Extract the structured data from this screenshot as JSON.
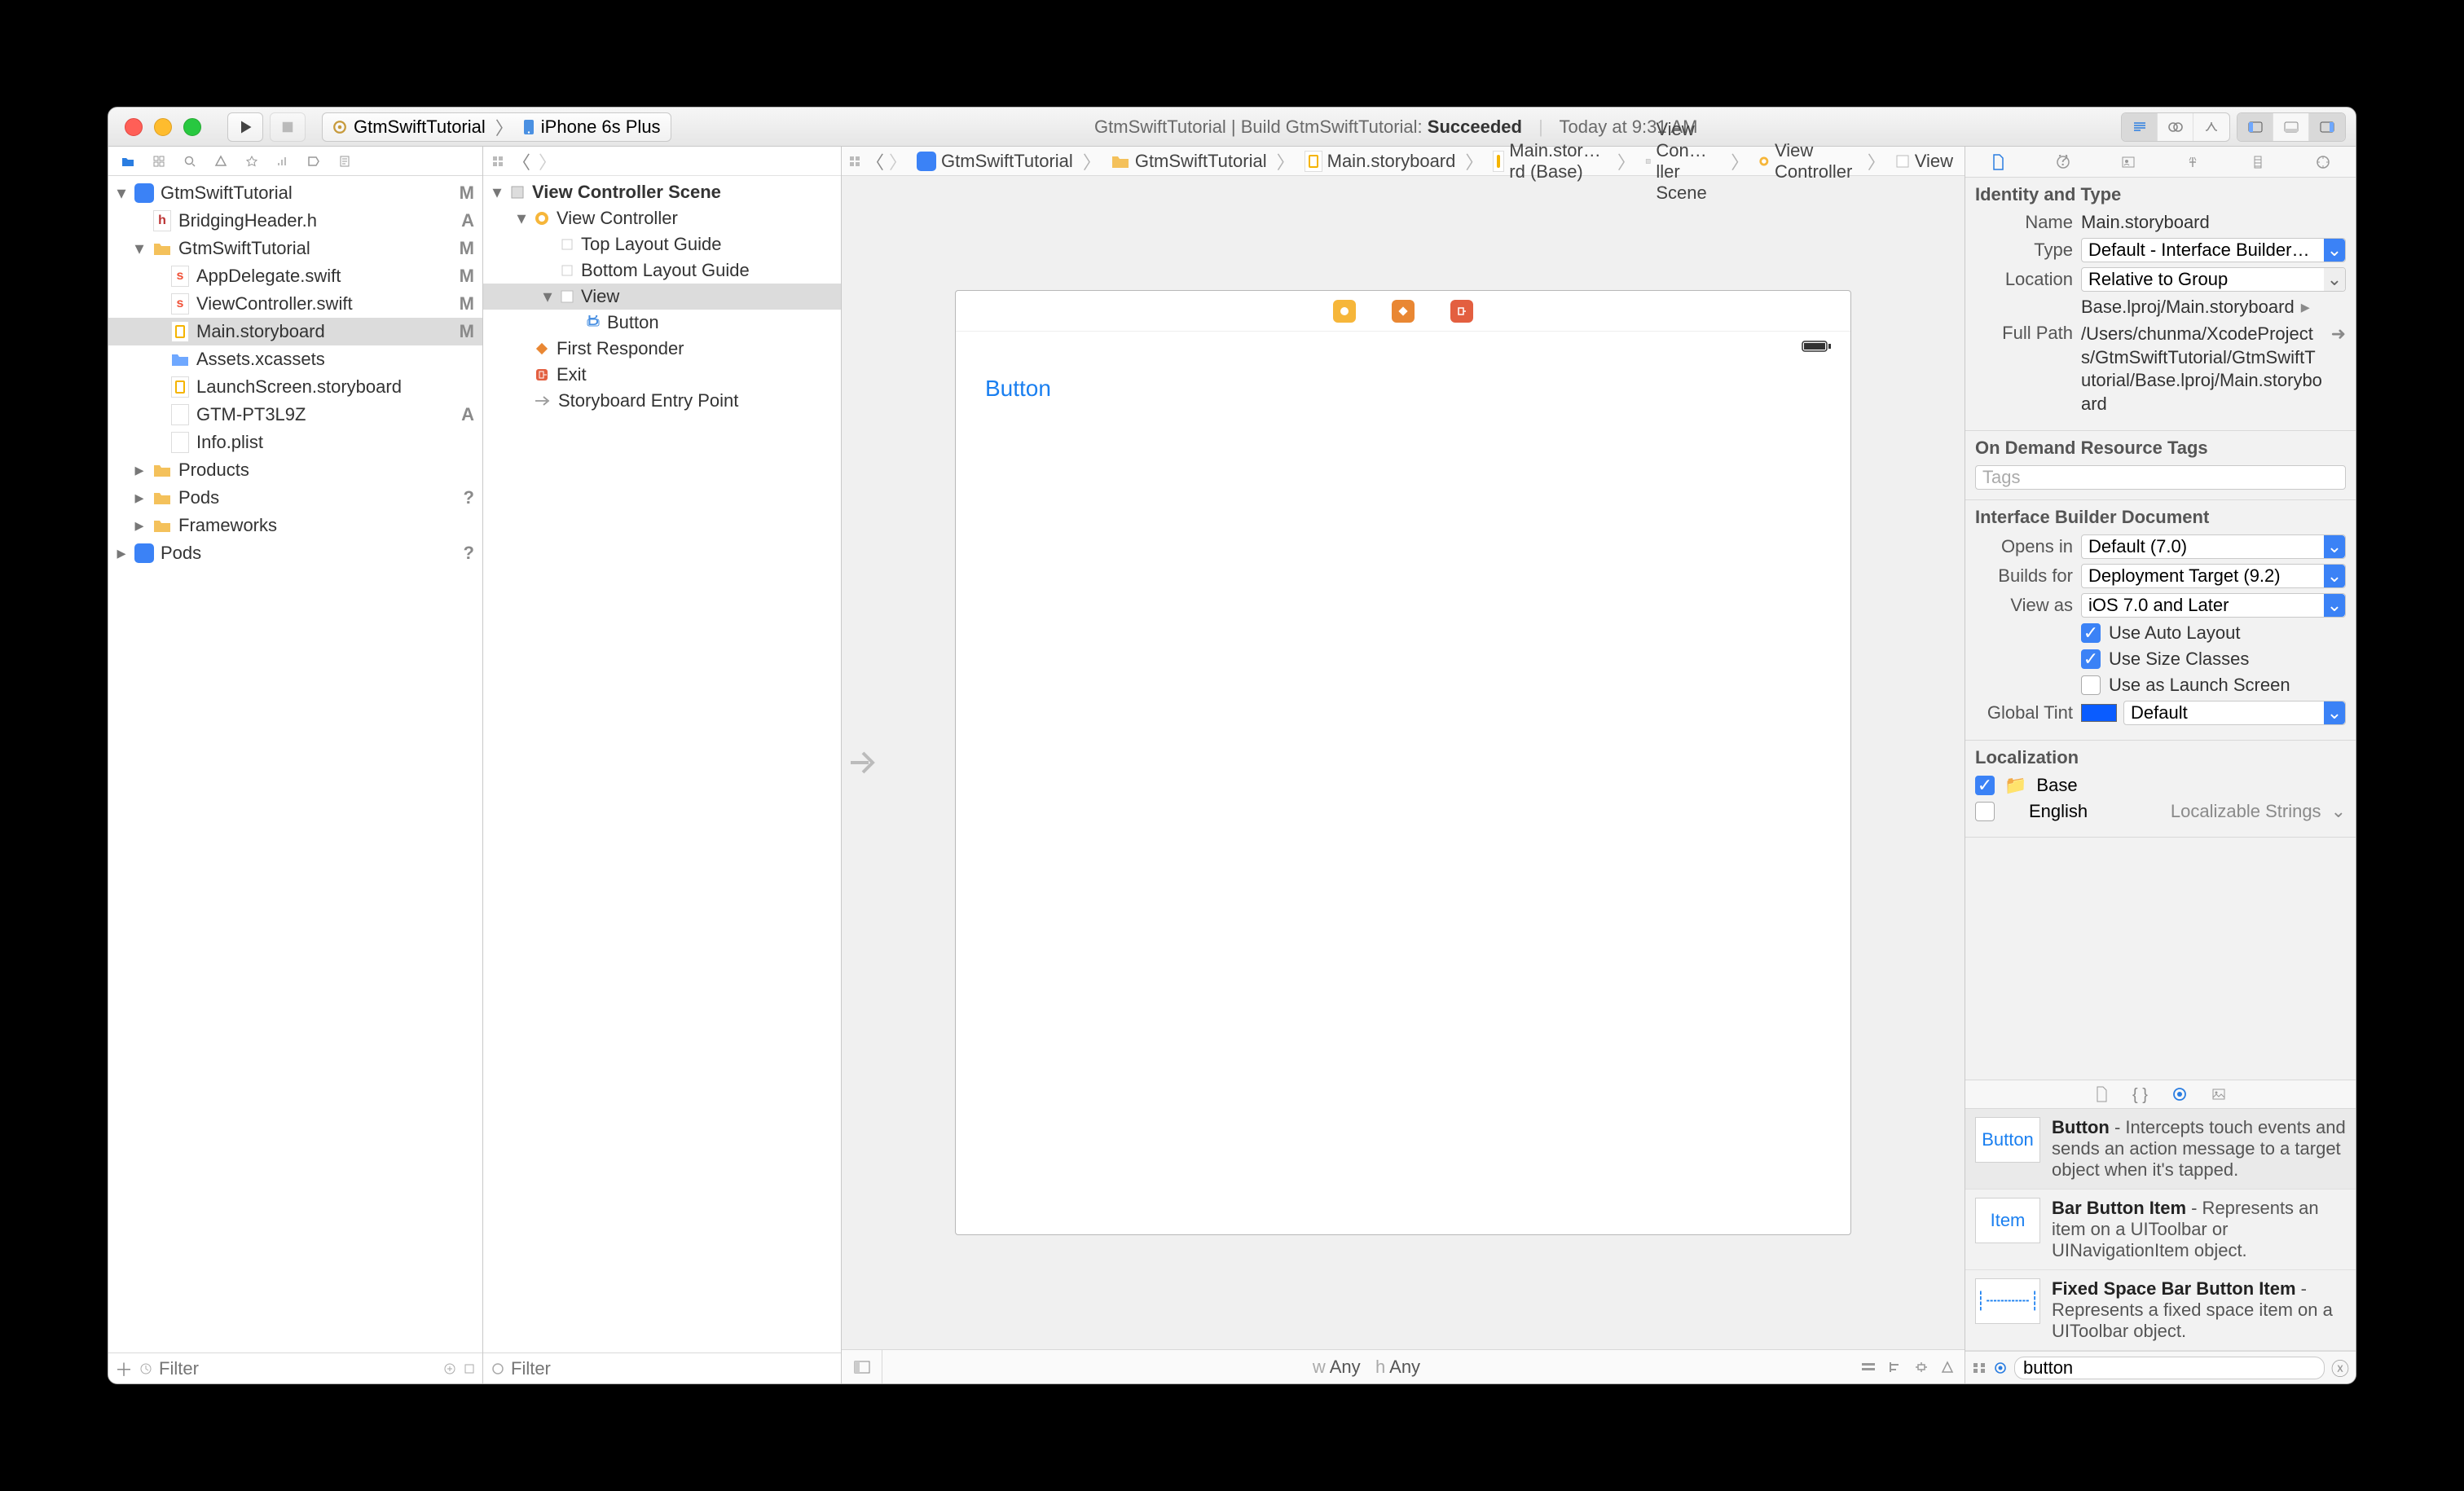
{
  "titlebar": {
    "scheme_app": "GtmSwiftTutorial",
    "scheme_device": "iPhone 6s Plus",
    "status_prefix": "GtmSwiftTutorial  |  Build GtmSwiftTutorial: ",
    "status_result": "Succeeded",
    "status_time": "Today at 9:31 AM"
  },
  "navigator": {
    "filter_placeholder": "Filter",
    "items": [
      {
        "indent": 0,
        "icon": "project",
        "label": "GtmSwiftTutorial",
        "status": "M",
        "open": true
      },
      {
        "indent": 1,
        "icon": "h",
        "label": "BridgingHeader.h",
        "status": "A"
      },
      {
        "indent": 1,
        "icon": "folder-yl",
        "label": "GtmSwiftTutorial",
        "status": "M",
        "open": true
      },
      {
        "indent": 2,
        "icon": "swift",
        "label": "AppDelegate.swift",
        "status": "M"
      },
      {
        "indent": 2,
        "icon": "swift",
        "label": "ViewController.swift",
        "status": "M"
      },
      {
        "indent": 2,
        "icon": "storyboard",
        "label": "Main.storyboard",
        "status": "M",
        "selected": true
      },
      {
        "indent": 2,
        "icon": "folder-bl",
        "label": "Assets.xcassets",
        "status": ""
      },
      {
        "indent": 2,
        "icon": "storyboard",
        "label": "LaunchScreen.storyboard",
        "status": ""
      },
      {
        "indent": 2,
        "icon": "plain",
        "label": "GTM-PT3L9Z",
        "status": "A"
      },
      {
        "indent": 2,
        "icon": "plain",
        "label": "Info.plist",
        "status": ""
      },
      {
        "indent": 1,
        "icon": "folder-yl",
        "label": "Products",
        "status": "",
        "open": false,
        "closed": true
      },
      {
        "indent": 1,
        "icon": "folder-yl",
        "label": "Pods",
        "status": "?",
        "open": false,
        "closed": true
      },
      {
        "indent": 1,
        "icon": "folder-yl",
        "label": "Frameworks",
        "status": "",
        "open": false,
        "closed": true
      },
      {
        "indent": 0,
        "icon": "project",
        "label": "Pods",
        "status": "?",
        "open": false,
        "closed": true
      }
    ]
  },
  "outline": {
    "filter_placeholder": "Filter",
    "items": [
      {
        "indent": 0,
        "icon": "scene",
        "label": "View Controller Scene",
        "bold": true,
        "open": true
      },
      {
        "indent": 1,
        "icon": "vc",
        "label": "View Controller",
        "open": true
      },
      {
        "indent": 2,
        "icon": "guide",
        "label": "Top Layout Guide"
      },
      {
        "indent": 2,
        "icon": "guide",
        "label": "Bottom Layout Guide"
      },
      {
        "indent": 2,
        "icon": "view",
        "label": "View",
        "open": true,
        "selected": true
      },
      {
        "indent": 3,
        "icon": "button",
        "label": "Button"
      },
      {
        "indent": 1,
        "icon": "responder",
        "label": "First Responder"
      },
      {
        "indent": 1,
        "icon": "exit",
        "label": "Exit"
      },
      {
        "indent": 1,
        "icon": "entry",
        "label": "Storyboard Entry Point"
      }
    ]
  },
  "jumpbar": {
    "crumbs": [
      {
        "icon": "project",
        "label": "GtmSwiftTutorial"
      },
      {
        "icon": "folder-yl",
        "label": "GtmSwiftTutorial"
      },
      {
        "icon": "storyboard",
        "label": "Main.storyboard"
      },
      {
        "icon": "storyboard",
        "label": "Main.stor…rd (Base)"
      },
      {
        "icon": "scene",
        "label": "View Con…ller Scene"
      },
      {
        "icon": "vc",
        "label": "View Controller"
      },
      {
        "icon": "view",
        "label": "View"
      }
    ]
  },
  "canvas": {
    "button_label": "Button",
    "size_label_w": "w Any",
    "size_label_h": "h Any"
  },
  "inspector": {
    "identity": {
      "section": "Identity and Type",
      "name_label": "Name",
      "name_value": "Main.storyboard",
      "type_label": "Type",
      "type_value": "Default - Interface Builder…",
      "location_label": "Location",
      "location_value": "Relative to Group",
      "location_path": "Base.lproj/Main.storyboard",
      "fullpath_label": "Full Path",
      "fullpath_value": "/Users/chunma/XcodeProjects/GtmSwiftTutorial/GtmSwiftTutorial/Base.lproj/Main.storyboard"
    },
    "ondemand": {
      "section": "On Demand Resource Tags",
      "placeholder": "Tags"
    },
    "ibdoc": {
      "section": "Interface Builder Document",
      "opensin_label": "Opens in",
      "opensin_value": "Default (7.0)",
      "buildsfor_label": "Builds for",
      "buildsfor_value": "Deployment Target (9.2)",
      "viewas_label": "View as",
      "viewas_value": "iOS 7.0 and Later",
      "chk_autolayout": "Use Auto Layout",
      "chk_sizeclasses": "Use Size Classes",
      "chk_launch": "Use as Launch Screen",
      "tint_label": "Global Tint",
      "tint_value": "Default"
    },
    "localization": {
      "section": "Localization",
      "base": "Base",
      "english": "English",
      "english_type": "Localizable Strings"
    },
    "library": {
      "search_value": "button",
      "items": [
        {
          "preview": "Button",
          "title": "Button",
          "desc": " - Intercepts touch events and sends an action message to a target object when it's tapped.",
          "selected": true
        },
        {
          "preview": "Item",
          "title": "Bar Button Item",
          "desc": " - Represents an item on a UIToolbar or UINavigationItem object."
        },
        {
          "preview": "┊┄┄┄┄┊",
          "title": "Fixed Space Bar Button Item",
          "desc": " - Represents a fixed space item on a UIToolbar object."
        }
      ]
    }
  }
}
